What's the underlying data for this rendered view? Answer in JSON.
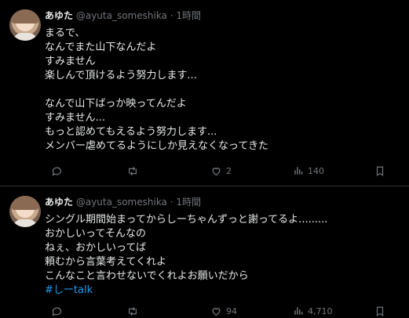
{
  "tweets": [
    {
      "author_name": "あゆた",
      "handle": "@ayuta_someshika",
      "separator": "·",
      "time": "1時間",
      "lines": [
        "まるで、",
        "なんでまた山下なんだよ",
        "すみません",
        "楽しんで頂けるよう努力します...",
        "",
        "なんで山下ばっか映ってんだよ",
        "すみません...",
        "もっと認めてもえるよう努力します...",
        "メンバー虐めてるようにしか見えなくなってきた"
      ],
      "replies": "",
      "retweets": "",
      "likes": "2",
      "views": "140"
    },
    {
      "author_name": "あゆた",
      "handle": "@ayuta_someshika",
      "separator": "·",
      "time": "1時間",
      "lines": [
        "シングル期間始まってからしーちゃんずっと謝ってるよ.........",
        "おかしいってそんなの",
        "ねぇ、おかしいってば",
        "頼むから言葉考えてくれよ",
        "こんなこと言わせないでくれよお願いだから"
      ],
      "hashtag": "#しーtalk",
      "replies": "",
      "retweets": "",
      "likes": "94",
      "views": "4,710"
    }
  ],
  "icons": [
    "reply-icon",
    "retweet-icon",
    "like-icon",
    "views-icon",
    "bookmark-icon"
  ],
  "colors": {
    "background": "#000000",
    "text": "#e7e9ea",
    "muted": "#71767b",
    "divider": "#2f3336",
    "link": "#1d9bf0"
  }
}
